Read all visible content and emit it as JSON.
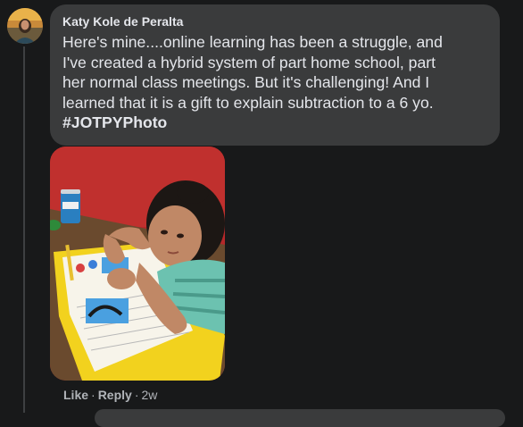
{
  "comment": {
    "author": "Katy Kole de Peralta",
    "text_lines": [
      "Here's mine....online learning has been a struggle, and",
      "I've created a hybrid system of part home school, part",
      "her normal class meetings. But it's challenging! And I",
      "learned that it is a gift to explain subtraction to a 6 yo."
    ],
    "hashtag": "#JOTPYPhoto"
  },
  "actions": {
    "like_label": "Like",
    "separator": "·",
    "reply_label": "Reply",
    "time": "2w"
  },
  "colors": {
    "background": "#18191a",
    "bubble": "#3a3b3c",
    "primary_text": "#e4e6eb",
    "secondary_text": "#b0b3b8"
  }
}
